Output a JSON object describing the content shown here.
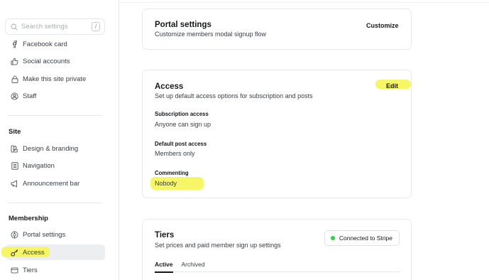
{
  "sidebar": {
    "search": {
      "placeholder": "Search settings",
      "shortcut": "/"
    },
    "general_items": [
      {
        "label": "Facebook card",
        "icon": "facebook-icon"
      },
      {
        "label": "Social accounts",
        "icon": "thumbs-up-icon"
      },
      {
        "label": "Make this site private",
        "icon": "lock-icon"
      },
      {
        "label": "Staff",
        "icon": "staff-icon"
      }
    ],
    "site": {
      "title": "Site",
      "items": [
        {
          "label": "Design & branding",
          "icon": "design-icon"
        },
        {
          "label": "Navigation",
          "icon": "navigation-icon"
        },
        {
          "label": "Announcement bar",
          "icon": "megaphone-icon"
        }
      ]
    },
    "membership": {
      "title": "Membership",
      "items": [
        {
          "label": "Portal settings",
          "icon": "portal-icon"
        },
        {
          "label": "Access",
          "icon": "key-icon",
          "active": true
        },
        {
          "label": "Tiers",
          "icon": "tiers-icon"
        }
      ]
    }
  },
  "portal": {
    "title": "Portal settings",
    "description": "Customize members modal signup flow",
    "action": "Customize"
  },
  "access": {
    "title": "Access",
    "description": "Set up default access options for subscription and posts",
    "action": "Edit",
    "fields": [
      {
        "label": "Subscription access",
        "value": "Anyone can sign up"
      },
      {
        "label": "Default post access",
        "value": "Members only"
      },
      {
        "label": "Commenting",
        "value": "Nobody"
      }
    ]
  },
  "tiers": {
    "title": "Tiers",
    "description": "Set prices and paid member sign up settings",
    "stripe_button": "Connected to Stripe",
    "tabs": [
      {
        "label": "Active",
        "active": true
      },
      {
        "label": "Archived",
        "active": false
      }
    ]
  },
  "colors": {
    "highlight": "#f5f55a",
    "stripe_status": "#30cf43",
    "active_nav_bg": "#eceef0"
  }
}
